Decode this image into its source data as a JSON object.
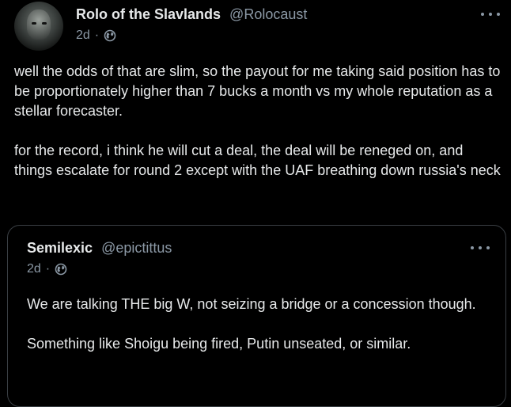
{
  "tweet": {
    "display_name": "Rolo of the Slavlands",
    "handle": "@Rolocaust",
    "time": "2d",
    "separator": "·",
    "visibility_icon": "globe-icon",
    "more_icon": "more-dots-icon",
    "text": "well the odds of that are slim, so the payout for me taking said position has to be proportionately higher than 7 bucks a month vs my whole reputation as a stellar forecaster.\n\nfor the record, i think he will cut a deal, the deal will be reneged on, and things escalate for round 2 except with the UAF breathing down russia's neck"
  },
  "quoted": {
    "display_name": "Semilexic",
    "handle": "@epictittus",
    "time": "2d",
    "separator": "·",
    "visibility_icon": "globe-icon",
    "more_icon": "more-dots-icon",
    "text": "We are talking THE big W, not seizing a bridge or a concession though.\n\nSomething like Shoigu being fired, Putin unseated, or similar."
  },
  "colors": {
    "background": "#000000",
    "text": "#e7e9ea",
    "muted": "#8b98a5",
    "border": "#3a3f44"
  }
}
